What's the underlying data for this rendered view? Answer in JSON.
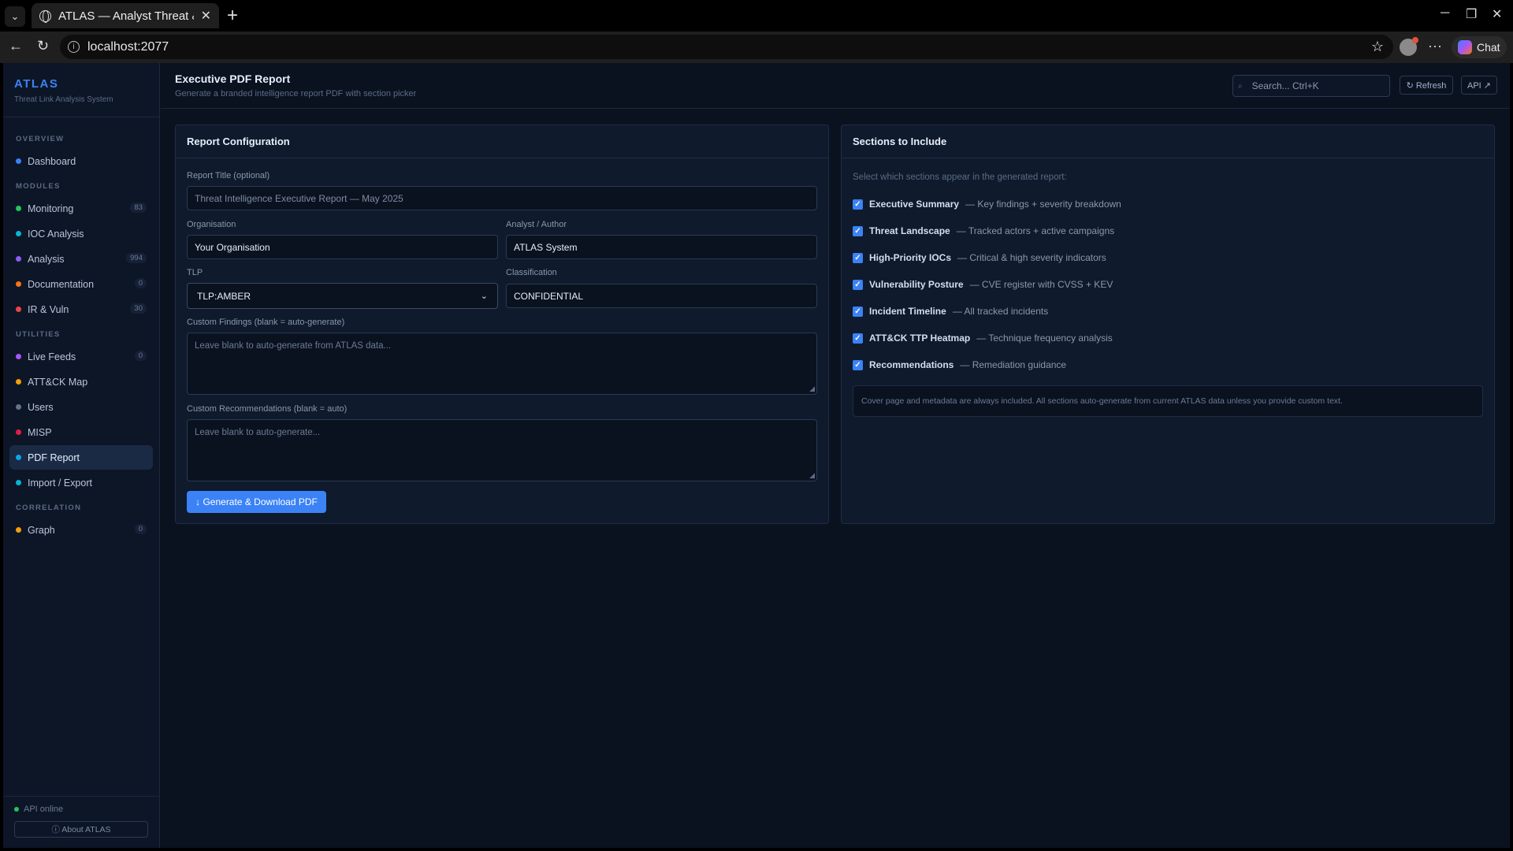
{
  "browser": {
    "tab_title": "ATLAS — Analyst Threat & I",
    "url": "localhost:2077",
    "chat_label": "Chat"
  },
  "app": {
    "brand": "ATLAS",
    "brand_sub": "Threat Link Analysis System",
    "nav": {
      "overview": "OVERVIEW",
      "dashboard": "Dashboard",
      "modules": "MODULES",
      "monitoring": "Monitoring",
      "monitoring_count": "83",
      "ioc": "IOC Analysis",
      "analysis": "Analysis",
      "analysis_count": "994",
      "documentation": "Documentation",
      "documentation_count": "0",
      "ir": "IR & Vuln",
      "ir_count": "30",
      "utilities": "UTILITIES",
      "live_feeds": "Live Feeds",
      "live_feeds_count": "0",
      "attack_map": "ATT&CK Map",
      "users": "Users",
      "misp": "MISP",
      "pdf_report": "PDF Report",
      "import_export": "Import / Export",
      "correlation": "CORRELATION",
      "graph": "Graph",
      "graph_count": "0"
    },
    "api_status": "API online",
    "about": "ⓘ About ATLAS",
    "colors": {
      "accent": "#3b82f6",
      "dashboard": "#3b82f6",
      "monitoring": "#22c55e",
      "ioc": "#06b6d4",
      "analysis": "#8b5cf6",
      "documentation": "#f97316",
      "ir": "#ef4444",
      "live_feeds": "#a855f7",
      "attack_map": "#f59e0b",
      "users": "#64748b",
      "misp": "#e11d48",
      "pdf_report": "#0ea5e9",
      "import_export": "#06b6d4",
      "graph": "#f59e0b"
    }
  },
  "header": {
    "title": "Executive PDF Report",
    "subtitle": "Generate a branded intelligence report PDF with section picker",
    "search_placeholder": "Search... Ctrl+K",
    "refresh": "↻ Refresh",
    "api": "API ↗"
  },
  "config": {
    "title": "Report Configuration",
    "report_title_label": "Report Title (optional)",
    "report_title_placeholder": "Threat Intelligence Executive Report — May 2025",
    "org_label": "Organisation",
    "org_value": "Your Organisation",
    "author_label": "Analyst / Author",
    "author_value": "ATLAS System",
    "tlp_label": "TLP",
    "tlp_value": "TLP:AMBER",
    "class_label": "Classification",
    "class_value": "CONFIDENTIAL",
    "findings_label": "Custom Findings (blank = auto-generate)",
    "findings_placeholder": "Leave blank to auto-generate from ATLAS data...",
    "recs_label": "Custom Recommendations (blank = auto)",
    "recs_placeholder": "Leave blank to auto-generate...",
    "generate": "↓ Generate & Download PDF"
  },
  "sections": {
    "title": "Sections to Include",
    "hint": "Select which sections appear in the generated report:",
    "items": [
      {
        "name": "Executive Summary",
        "desc": "— Key findings + severity breakdown",
        "checked": true
      },
      {
        "name": "Threat Landscape",
        "desc": "— Tracked actors + active campaigns",
        "checked": true
      },
      {
        "name": "High-Priority IOCs",
        "desc": "— Critical & high severity indicators",
        "checked": true
      },
      {
        "name": "Vulnerability Posture",
        "desc": "— CVE register with CVSS + KEV",
        "checked": true
      },
      {
        "name": "Incident Timeline",
        "desc": "— All tracked incidents",
        "checked": true
      },
      {
        "name": "ATT&CK TTP Heatmap",
        "desc": "— Technique frequency analysis",
        "checked": true
      },
      {
        "name": "Recommendations",
        "desc": "— Remediation guidance",
        "checked": true
      }
    ],
    "note": "Cover page and metadata are always included. All sections auto-generate from current ATLAS data unless you provide custom text."
  }
}
